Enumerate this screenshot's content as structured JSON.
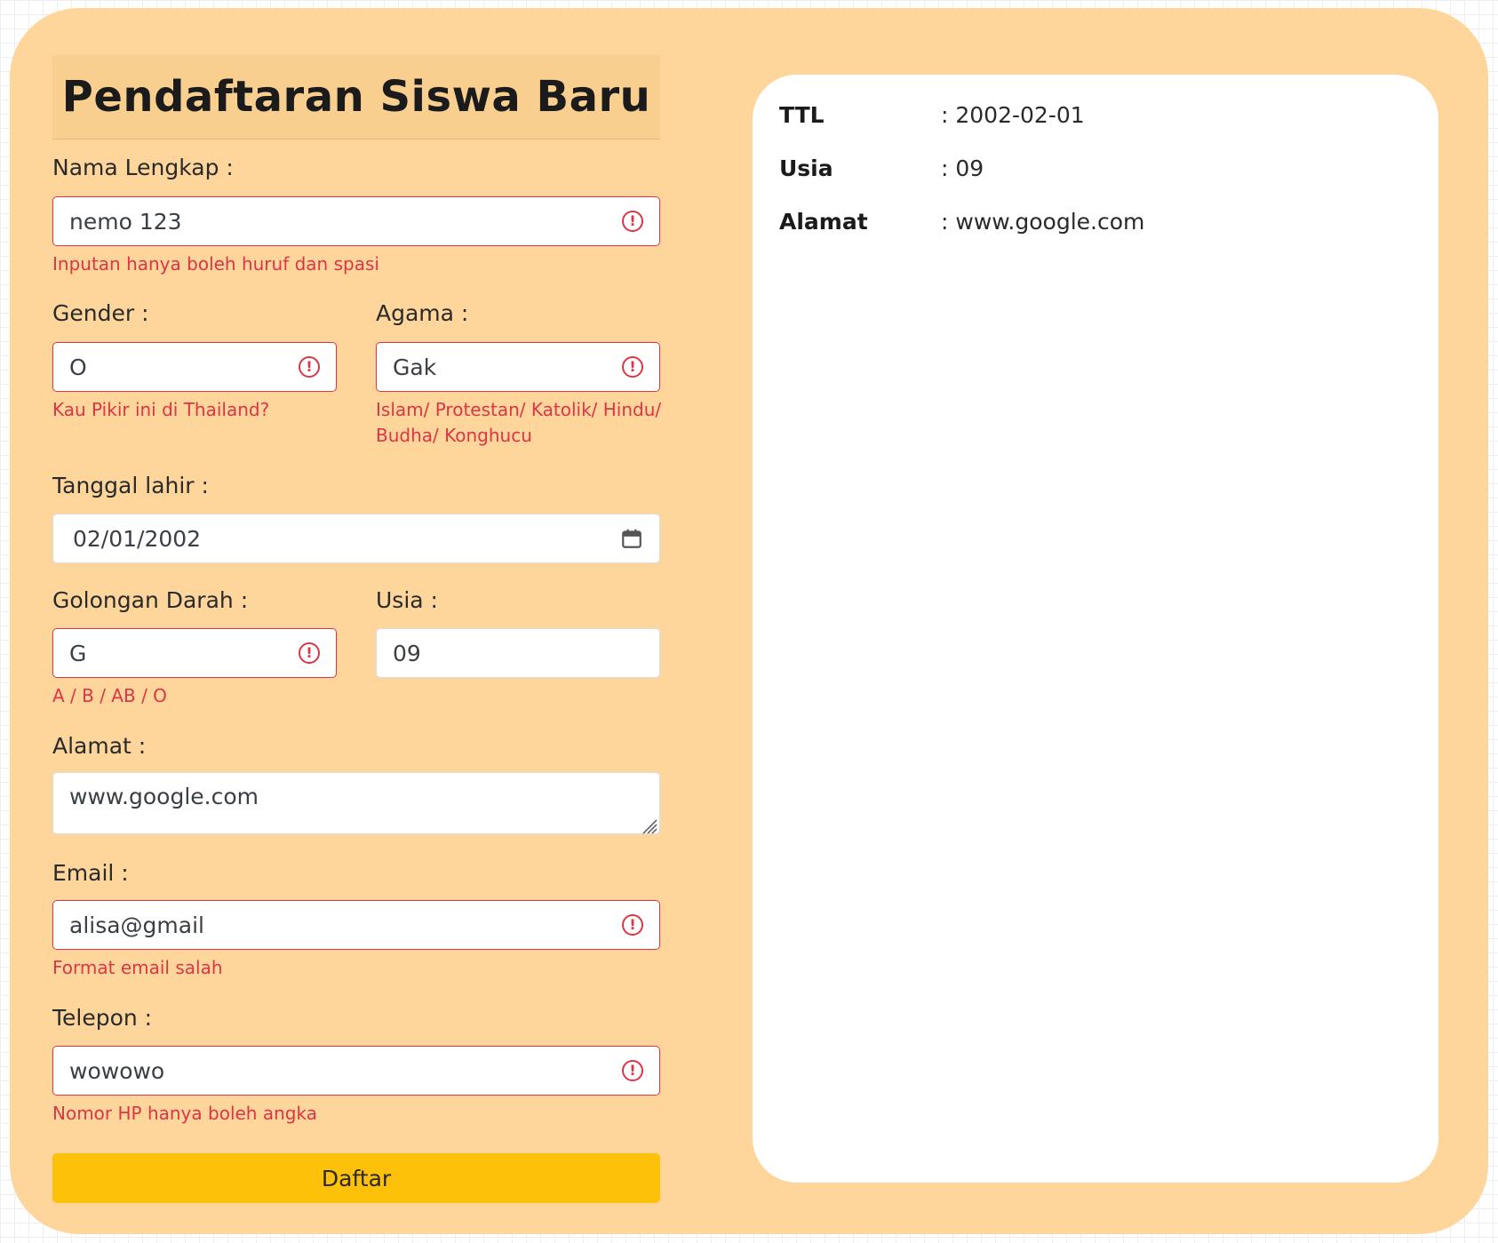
{
  "form": {
    "title": "Pendaftaran Siswa Baru",
    "nama": {
      "label": "Nama Lengkap :",
      "value": "nemo 123",
      "error": "Inputan hanya boleh huruf dan spasi"
    },
    "gender": {
      "label": "Gender :",
      "value": "O",
      "error": "Kau Pikir ini di Thailand?"
    },
    "agama": {
      "label": "Agama :",
      "value": "Gak",
      "error_line1": "Islam/ Protestan/ Katolik/ Hindu/",
      "error_line2": "Budha/ Konghucu"
    },
    "tanggal_lahir": {
      "label": "Tanggal lahir :",
      "value": "02/01/2002"
    },
    "golongan_darah": {
      "label": "Golongan Darah :",
      "value": "G",
      "error": "A / B / AB / O"
    },
    "usia": {
      "label": "Usia :",
      "value": "09"
    },
    "alamat": {
      "label": "Alamat :",
      "value": "www.google.com"
    },
    "email": {
      "label": "Email :",
      "value": "alisa@gmail",
      "error": "Format email salah"
    },
    "telepon": {
      "label": "Telepon :",
      "value": "wowowo",
      "error": "Nomor HP hanya boleh angka"
    },
    "submit_label": "Daftar",
    "error_icon": "!"
  },
  "preview": {
    "rows": [
      {
        "key": "TTL",
        "value": ": 2002-02-01"
      },
      {
        "key": "Usia",
        "value": ": 09"
      },
      {
        "key": "Alamat",
        "value": ": www.google.com"
      }
    ]
  },
  "colors": {
    "card": "#fed69c",
    "header": "#f8cf8f",
    "error": "#dc3545",
    "button": "#fdc10a"
  },
  "icons": {
    "error": "exclamation-circle-icon",
    "calendar": "calendar-icon",
    "resize": "resize-grip-icon"
  }
}
